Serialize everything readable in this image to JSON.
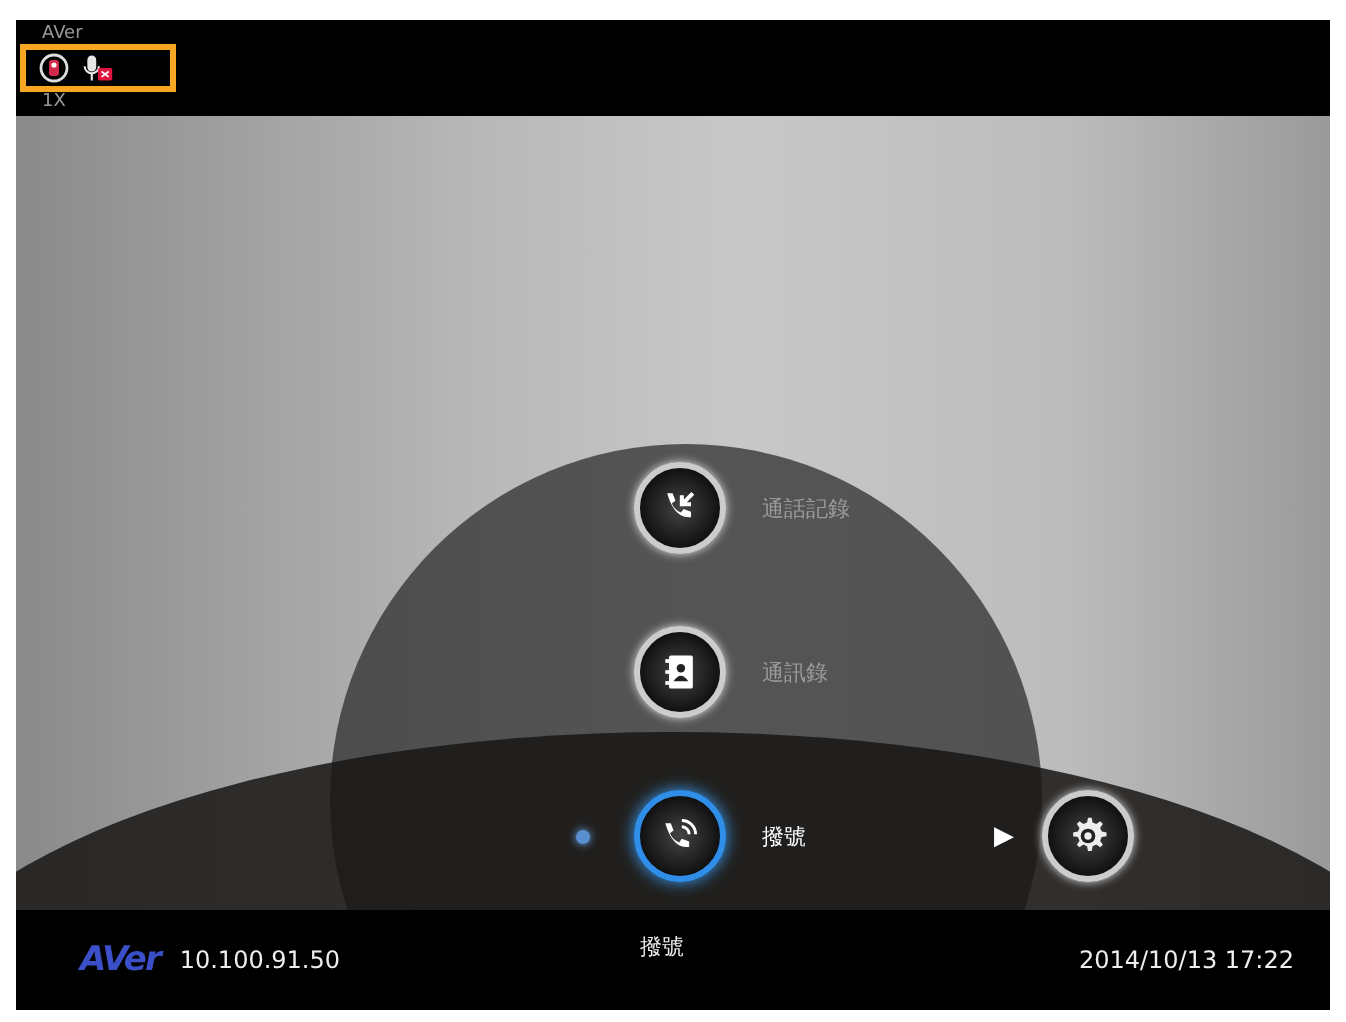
{
  "status": {
    "brand": "AVer",
    "zoom": "1X",
    "mic_muted": true
  },
  "menu": [
    {
      "label": "通話記錄",
      "selected": false
    },
    {
      "label": "通訊錄",
      "selected": false
    },
    {
      "label": "撥號",
      "selected": true
    }
  ],
  "settings": {
    "arrow": "▶"
  },
  "footer": {
    "logo": "AVer",
    "ip": "10.100.91.50",
    "mode": "撥號",
    "datetime": "2014/10/13 17:22"
  }
}
